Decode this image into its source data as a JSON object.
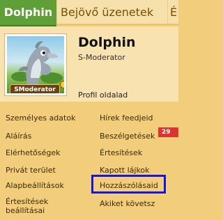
{
  "tabs": {
    "active": "Dolphin",
    "inbox": "Bejövő üzenetek",
    "more": "É"
  },
  "profile": {
    "username": "Dolphin",
    "role": "S-Moderator",
    "avatar_badge": "SModerator",
    "profile_link": "Profil oldalad"
  },
  "menu": {
    "left": [
      "Személyes adatok",
      "Aláírás",
      "Elérhetőségek",
      "Privát terület",
      "Alapbeállítások",
      "Értesítések beállításai"
    ],
    "right": [
      "Hírek feedjeid",
      "Beszélgetések",
      "Értesítések",
      "Kapott lájkok",
      "Hozzászólásaid",
      "Akiket követsz"
    ],
    "notifications_count": "29",
    "highlighted_item": "Hozzászólásaid"
  },
  "colors": {
    "active_tab": "#5f9f38",
    "menu_bg": "#f2ce7c",
    "profile_bg": "#f7e2b0",
    "highlight_border": "#1515dd",
    "badge": "#d33333"
  }
}
